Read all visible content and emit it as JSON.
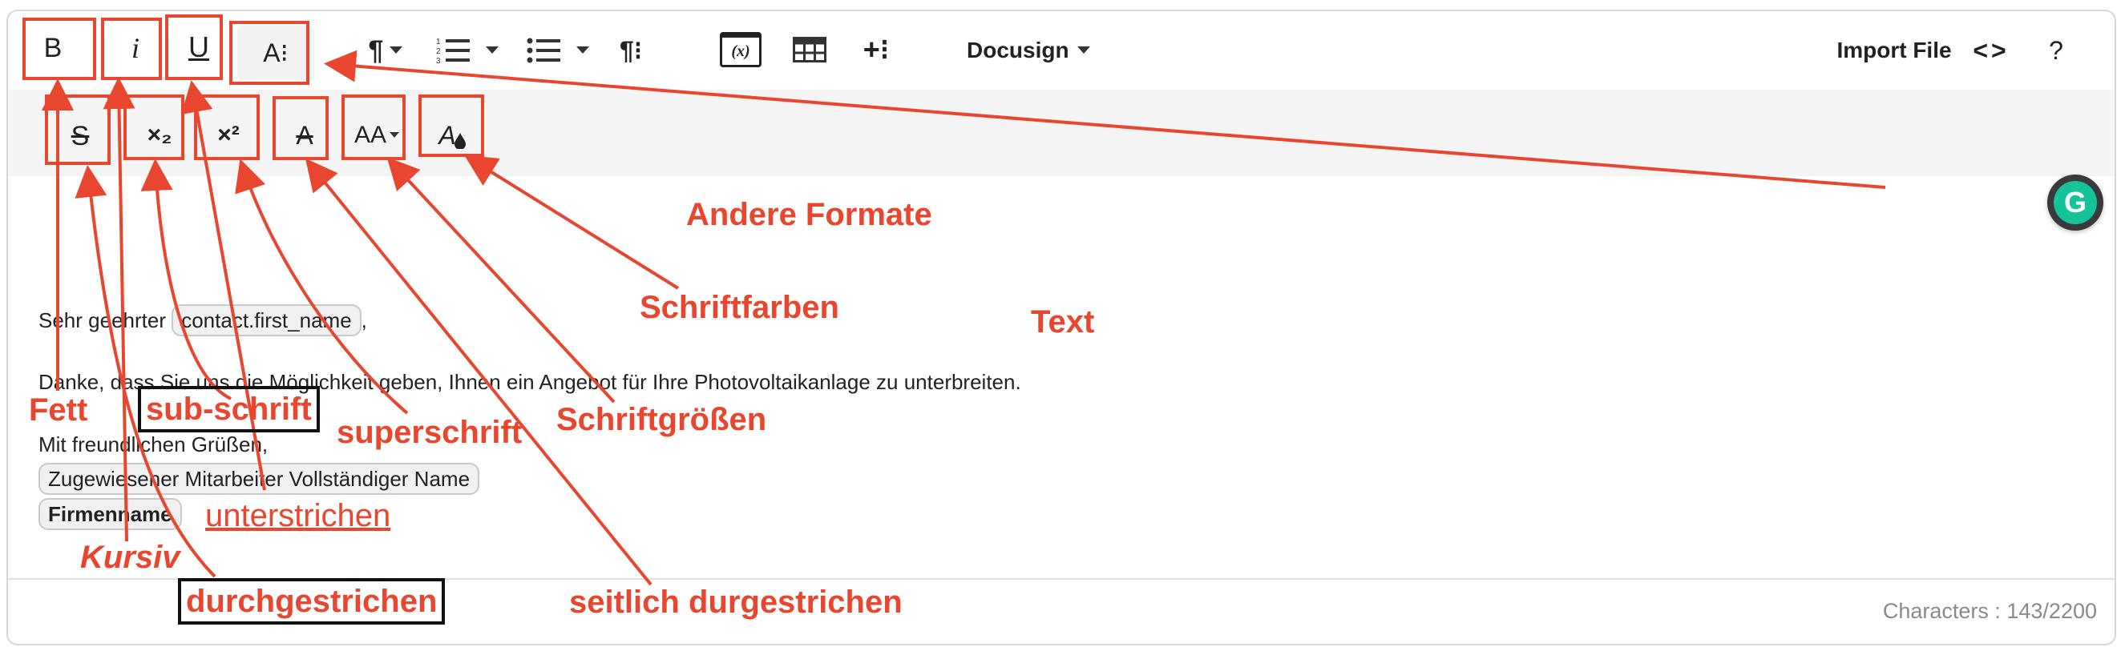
{
  "toolbar": {
    "bold_label": "B",
    "italic_label": "i",
    "underline_label": "U",
    "more_formats_label": "A⁝",
    "paragraph_format_label": "¶",
    "ordered_list_label": "≡",
    "unordered_list_label": "≡",
    "paragraph_style_label": "¶⁝",
    "variable_label": "(x)",
    "table_label": "table",
    "insert_more_label": "+⁝",
    "docusign_label": "Docusign",
    "import_file_label": "Import File",
    "code_view_label": "<>",
    "help_label": "?"
  },
  "toolbar2": {
    "strikethrough": "S",
    "subscript": "×₂",
    "superscript": "×²",
    "clear_format": "A",
    "font_size": "AA",
    "font_color": "A"
  },
  "content": {
    "greeting_text": "Sehr geehrter",
    "greeting_chip": "contact.first_name",
    "greeting_suffix": ",",
    "line2": "Danke, dass Sie uns die Möglichkeit geben, Ihnen ein Angebot für Ihre Photovoltaikanlage zu unterbreiten.",
    "line3": "Mit freundlichen Grüßen,",
    "assigned_chip": "Zugewiesener Mitarbeiter Vollständiger Name",
    "company_chip": "Firmenname"
  },
  "footer": {
    "char_count": "Characters : 143/2200"
  },
  "grammarly": {
    "letter": "G"
  },
  "annotations": {
    "fett": "Fett",
    "kursiv": "Kursiv",
    "unterstrichen": "unterstrichen",
    "andere_formate": "Andere Formate",
    "durchgestrichen": "durchgestrichen",
    "sub_schrift": "sub-schrift",
    "superschrift": "superschrift",
    "seitlich": "seitlich durgestrichen",
    "schriftgroessen": "Schriftgrößen",
    "schriftfarben": "Schriftfarben",
    "text": "Text"
  },
  "colors": {
    "annotation_red": "#e8462f",
    "toolbar2_bg": "#f4f4f4",
    "grammarly_green": "#15c39a"
  }
}
